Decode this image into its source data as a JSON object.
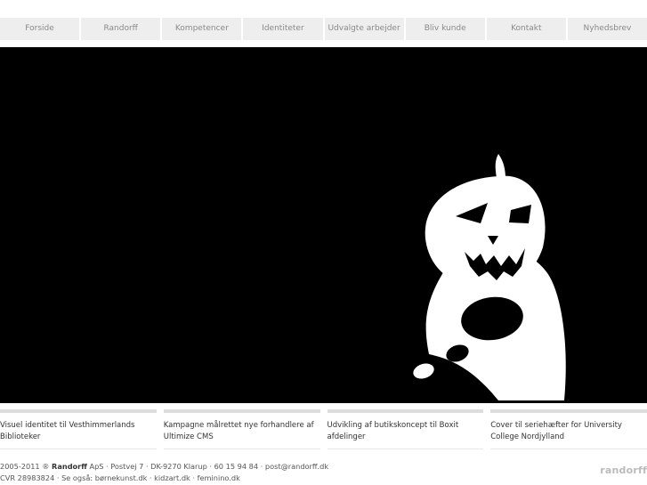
{
  "nav": {
    "items": [
      {
        "label": "Forside"
      },
      {
        "label": "Randorff"
      },
      {
        "label": "Kompetencer"
      },
      {
        "label": "Identiteter"
      },
      {
        "label": "Udvalgte arbejder"
      },
      {
        "label": "Bliv kunde"
      },
      {
        "label": "Kontakt"
      },
      {
        "label": "Nyhedsbrev"
      }
    ]
  },
  "hero": {
    "background": "#000000",
    "figure_color": "#ffffff"
  },
  "projects": [
    {
      "label": "Visuel identitet til Vesthimmerlands Biblioteker"
    },
    {
      "label": "Kampagne målrettet nye forhandlere af Ultimize CMS"
    },
    {
      "label": "Udvikling af butikskoncept til Boxit afdelinger"
    },
    {
      "label": "Cover til seriehæfter for University College Nordjylland"
    }
  ],
  "footer": {
    "line1_prefix": "2005-2011 ® ",
    "brand": "Randorff",
    "line1_suffix": " ApS · Postvej 7 · DK-9270 Klarup · 60 15 94 84 · post@randorff.dk",
    "line2_prefix": "CVR 28983824 · Se også: ",
    "links": [
      "børnekunst.dk",
      "kidzart.dk",
      "feminino.dk"
    ],
    "separator": " · "
  },
  "logo": {
    "text": "randorff"
  },
  "colors": {
    "nav_bg": "#eeeeee",
    "nav_text": "#8a8a8a",
    "project_bar": "#dddddd"
  }
}
